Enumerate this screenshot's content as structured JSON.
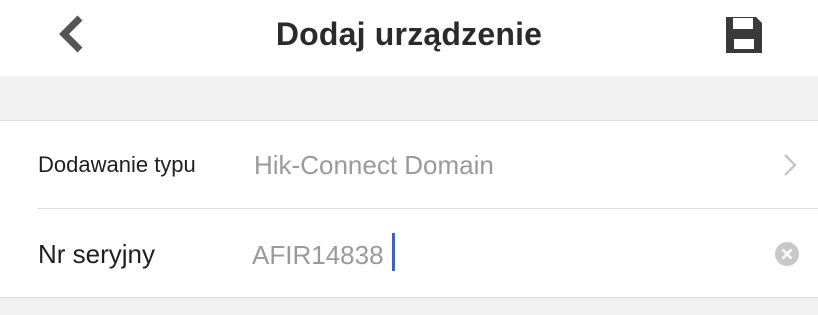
{
  "header": {
    "title": "Dodaj urządzenie",
    "back_icon": "chevron-left-icon",
    "save_icon": "floppy-disk-icon"
  },
  "form": {
    "add_type": {
      "label": "Dodawanie typu",
      "value": "Hik-Connect Domain",
      "icon": "chevron-right-icon"
    },
    "serial": {
      "label": "Nr seryjny",
      "value": "AFIR14838",
      "icon": "clear-icon"
    }
  },
  "colors": {
    "title_text": "#2b2b2b",
    "label_text": "#1f1f1f",
    "value_text": "#9a9a9a",
    "band": "#f1f1f1",
    "divider": "#dcdcdc",
    "caret": "#2b63f0",
    "icon_dark": "#3a3a3a"
  }
}
